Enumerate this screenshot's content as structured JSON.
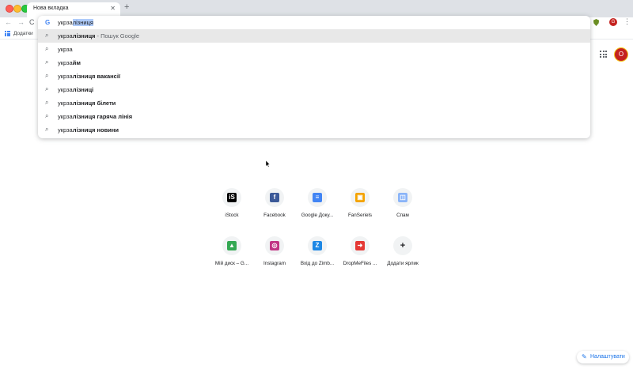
{
  "tab": {
    "title": "Нова вкладка",
    "close": "✕",
    "new_tab": "+"
  },
  "toolbar": {
    "back": "←",
    "forward": "→",
    "reload": "C"
  },
  "extension": {
    "profile_initial": "G",
    "menu": "⋮"
  },
  "bookmarks": {
    "apps_label": "Додатки"
  },
  "omnibox": {
    "typed_prefix": "укрза",
    "autocomplete": "лізниця",
    "suggestions": [
      {
        "prefix": "укрза",
        "bold": "лізниця",
        "suffix": " - Пошук Google",
        "highlighted": true
      },
      {
        "prefix": "укрза",
        "bold": "",
        "suffix": "",
        "highlighted": false
      },
      {
        "prefix": "укрза",
        "bold": "йм",
        "suffix": "",
        "highlighted": false
      },
      {
        "prefix": "укрза",
        "bold": "лізниця вакансії",
        "suffix": "",
        "highlighted": false
      },
      {
        "prefix": "укрза",
        "bold": "лізниці",
        "suffix": "",
        "highlighted": false
      },
      {
        "prefix": "укрза",
        "bold": "лізниця білети",
        "suffix": "",
        "highlighted": false
      },
      {
        "prefix": "укрза",
        "bold": "лізниця гаряча лінія",
        "suffix": "",
        "highlighted": false
      },
      {
        "prefix": "укрза",
        "bold": "лізниця новини",
        "suffix": "",
        "highlighted": false
      }
    ]
  },
  "header": {
    "avatar_initial": "O"
  },
  "shortcuts": [
    {
      "label": "iStock",
      "glyph": "iS",
      "color": "#000000",
      "icon": "istock-icon"
    },
    {
      "label": "Facebook",
      "glyph": "f",
      "color": "#3b5998",
      "icon": "facebook-icon"
    },
    {
      "label": "Google Доку...",
      "glyph": "≡",
      "color": "#4285f4",
      "icon": "google-docs-icon"
    },
    {
      "label": "FanSeriels",
      "glyph": "▣",
      "color": "#f4a300",
      "icon": "fanseriels-icon"
    },
    {
      "label": "Спам",
      "glyph": "◫",
      "color": "#8ab4f8",
      "icon": "spam-icon"
    },
    {
      "label": "Мій диск – G...",
      "glyph": "▲",
      "color": "#34a853",
      "icon": "google-drive-icon"
    },
    {
      "label": "Instagram",
      "glyph": "◎",
      "color": "#c13584",
      "icon": "instagram-icon"
    },
    {
      "label": "Вхід до Zimb...",
      "glyph": "Z",
      "color": "#1e88e5",
      "icon": "zimbra-icon"
    },
    {
      "label": "DropMeFiles ...",
      "glyph": "➜",
      "color": "#e53935",
      "icon": "dropmefiles-icon"
    },
    {
      "label": "Додати ярлик",
      "glyph": "+",
      "color": "#f1f3f4",
      "icon": "add-shortcut-icon"
    }
  ],
  "customize": {
    "label": "Налаштувати",
    "icon": "✎"
  }
}
